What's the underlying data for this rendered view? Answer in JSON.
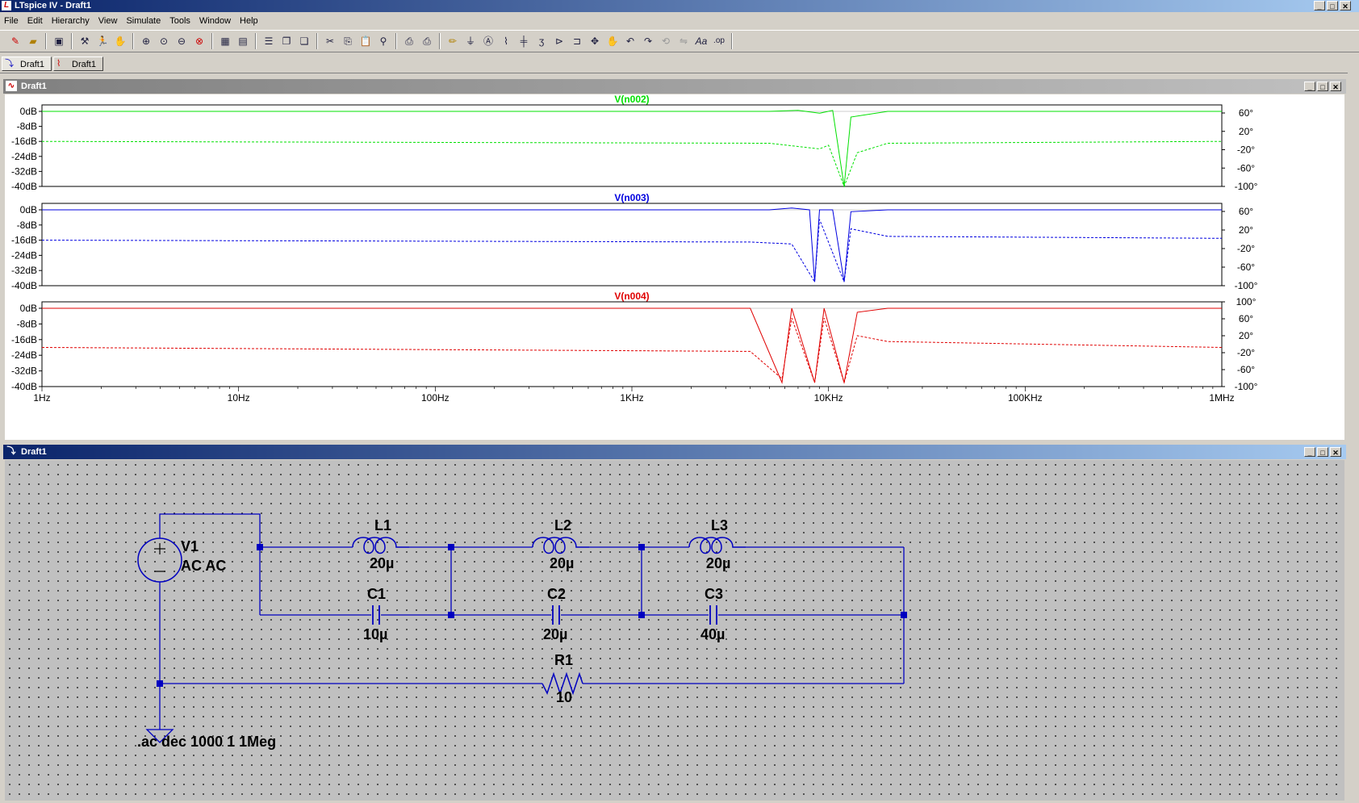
{
  "app": {
    "title": "LTspice IV - Draft1",
    "logo_letter": "L"
  },
  "menu": [
    "File",
    "Edit",
    "Hierarchy",
    "View",
    "Simulate",
    "Tools",
    "Window",
    "Help"
  ],
  "window_buttons": [
    "_",
    "□",
    "✕"
  ],
  "tabs": [
    {
      "label": "Draft1",
      "icon": "schematic-icon"
    },
    {
      "label": "Draft1",
      "icon": "waveform-icon"
    }
  ],
  "waveform_window": {
    "title": "Draft1"
  },
  "schematic_window": {
    "title": "Draft1"
  },
  "colors": {
    "n002": "#00e000",
    "n003": "#0000e0",
    "n004": "#e00000",
    "wire": "#0000c0",
    "text": "#000000"
  },
  "chart_data": [
    {
      "type": "line",
      "title": "V(n002)",
      "x_scale": "log",
      "xlim": [
        "1Hz",
        "1MHz"
      ],
      "y_ticks_left": [
        "0dB",
        "-8dB",
        "-16dB",
        "-24dB",
        "-32dB",
        "-40dB"
      ],
      "y_ticks_right": [
        "60°",
        "20°",
        "-20°",
        "-60°",
        "-100°"
      ],
      "series": [
        {
          "name": "V(n002)",
          "style": "solid",
          "points": [
            [
              1,
              0
            ],
            [
              5000,
              0
            ],
            [
              7000,
              0.5
            ],
            [
              9000,
              -1
            ],
            [
              10500,
              0.5
            ],
            [
              12000,
              -40
            ],
            [
              13000,
              -3
            ],
            [
              20000,
              0
            ],
            [
              1000000,
              0
            ]
          ]
        },
        {
          "style": "dashed",
          "points": [
            [
              1,
              -16
            ],
            [
              5000,
              -17
            ],
            [
              9000,
              -20
            ],
            [
              10000,
              -18
            ],
            [
              12000,
              -40
            ],
            [
              14000,
              -22
            ],
            [
              20000,
              -17
            ],
            [
              1000000,
              -16
            ]
          ]
        }
      ]
    },
    {
      "type": "line",
      "title": "V(n003)",
      "x_scale": "log",
      "xlim": [
        "1Hz",
        "1MHz"
      ],
      "y_ticks_left": [
        "0dB",
        "-8dB",
        "-16dB",
        "-24dB",
        "-32dB",
        "-40dB"
      ],
      "y_ticks_right": [
        "60°",
        "20°",
        "-20°",
        "-60°",
        "-100°"
      ],
      "series": [
        {
          "name": "V(n003)",
          "style": "solid",
          "points": [
            [
              1,
              0
            ],
            [
              5000,
              0
            ],
            [
              6500,
              1
            ],
            [
              8000,
              0
            ],
            [
              8500,
              -38
            ],
            [
              9000,
              0
            ],
            [
              10500,
              0
            ],
            [
              12000,
              -38
            ],
            [
              13000,
              -1
            ],
            [
              20000,
              0
            ],
            [
              1000000,
              0
            ]
          ]
        },
        {
          "style": "dashed",
          "points": [
            [
              1,
              -16
            ],
            [
              4000,
              -17
            ],
            [
              6500,
              -18
            ],
            [
              8500,
              -38
            ],
            [
              9000,
              -5
            ],
            [
              12000,
              -38
            ],
            [
              13000,
              -10
            ],
            [
              20000,
              -14
            ],
            [
              1000000,
              -15
            ]
          ]
        }
      ]
    },
    {
      "type": "line",
      "title": "V(n004)",
      "x_scale": "log",
      "xlim": [
        "1Hz",
        "1MHz"
      ],
      "x_ticks": [
        "1Hz",
        "10Hz",
        "100Hz",
        "1KHz",
        "10KHz",
        "100KHz",
        "1MHz"
      ],
      "y_ticks_left": [
        "0dB",
        "-8dB",
        "-16dB",
        "-24dB",
        "-32dB",
        "-40dB"
      ],
      "y_ticks_right": [
        "100°",
        "60°",
        "20°",
        "-20°",
        "-60°",
        "-100°"
      ],
      "series": [
        {
          "name": "V(n004)",
          "style": "solid",
          "points": [
            [
              1,
              0
            ],
            [
              4000,
              0
            ],
            [
              5800,
              -38
            ],
            [
              6500,
              0
            ],
            [
              8500,
              -38
            ],
            [
              9500,
              0
            ],
            [
              12000,
              -38
            ],
            [
              14000,
              -2
            ],
            [
              20000,
              0
            ],
            [
              1000000,
              0
            ]
          ]
        },
        {
          "style": "dashed",
          "points": [
            [
              1,
              -20
            ],
            [
              4000,
              -22
            ],
            [
              5800,
              -36
            ],
            [
              6500,
              -5
            ],
            [
              8500,
              -38
            ],
            [
              9500,
              -5
            ],
            [
              12000,
              -38
            ],
            [
              14000,
              -14
            ],
            [
              20000,
              -17
            ],
            [
              1000000,
              -20
            ]
          ]
        }
      ]
    }
  ],
  "schematic": {
    "components": [
      {
        "ref": "V1",
        "value": "AC AC"
      },
      {
        "ref": "L1",
        "value": "20µ"
      },
      {
        "ref": "L2",
        "value": "20µ"
      },
      {
        "ref": "L3",
        "value": "20µ"
      },
      {
        "ref": "C1",
        "value": "10µ"
      },
      {
        "ref": "C2",
        "value": "20µ"
      },
      {
        "ref": "C3",
        "value": "40µ"
      },
      {
        "ref": "R1",
        "value": "10"
      }
    ],
    "directive": ".ac dec 1000 1 1Meg"
  }
}
